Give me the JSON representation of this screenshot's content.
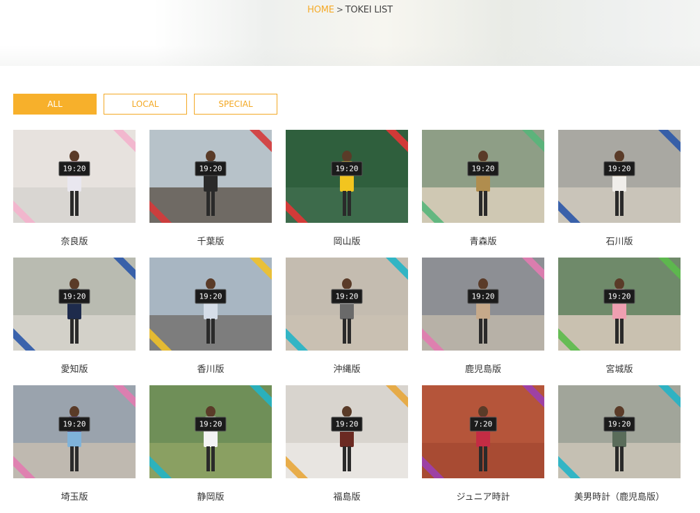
{
  "breadcrumb": {
    "home": "HOME",
    "separator": ">",
    "current": "TOKEI LIST"
  },
  "filters": [
    {
      "label": "ALL",
      "active": true
    },
    {
      "label": "LOCAL",
      "active": false
    },
    {
      "label": "SPECIAL",
      "active": false
    }
  ],
  "accent_color": "#f7b02b",
  "items": [
    {
      "caption": "奈良版",
      "sign": "19:20",
      "bg": "#e7e2de",
      "ground": "#d9d6d2",
      "top": "#f3c7d6",
      "body": "#e9e7ef",
      "ribbon": "#f3b2cc"
    },
    {
      "caption": "千葉版",
      "sign": "19:20",
      "bg": "#b7c2c9",
      "ground": "#6f6a64",
      "top": "#1e1e1e",
      "body": "#2a2a2a",
      "ribbon": "#d53a3a"
    },
    {
      "caption": "岡山版",
      "sign": "19:20",
      "bg": "#2f5f3d",
      "ground": "#3d6b4b",
      "top": "#f3c526",
      "body": "#f2c51f",
      "ribbon": "#e23636"
    },
    {
      "caption": "青森版",
      "sign": "19:20",
      "bg": "#8e9e86",
      "ground": "#cfc8b3",
      "top": "#c9a66a",
      "body": "#b08d4e",
      "ribbon": "#57b57a"
    },
    {
      "caption": "石川版",
      "sign": "19:20",
      "bg": "#a9a8a2",
      "ground": "#c9c4b9",
      "top": "#f0d7b8",
      "body": "#f0eeea",
      "ribbon": "#2a56a8"
    },
    {
      "caption": "愛知版",
      "sign": "19:20",
      "bg": "#b9bbb1",
      "ground": "#d3d1c9",
      "top": "#3c4a63",
      "body": "#1e2b4c",
      "ribbon": "#2a56a8"
    },
    {
      "caption": "香川版",
      "sign": "19:20",
      "bg": "#a8b6c2",
      "ground": "#7d7d7d",
      "top": "#d9dfe7",
      "body": "#d5dde8",
      "ribbon": "#f0c12a"
    },
    {
      "caption": "沖縄版",
      "sign": "19:20",
      "bg": "#c4bcb0",
      "ground": "#c9c0b2",
      "top": "#f2f2f2",
      "body": "#6a6a6a",
      "ribbon": "#22b4c7"
    },
    {
      "caption": "鹿児島版",
      "sign": "19:20",
      "bg": "#8d8f94",
      "ground": "#b7b1a7",
      "top": "#d9c3a7",
      "body": "#c6a98a",
      "ribbon": "#e27bb0"
    },
    {
      "caption": "宮城版",
      "sign": "19:20",
      "bg": "#6f8a6a",
      "ground": "#c9c1b0",
      "top": "#e8a9b4",
      "body": "#ef9fb1",
      "ribbon": "#5bbb4b"
    },
    {
      "caption": "埼玉版",
      "sign": "19:20",
      "bg": "#9aa3ad",
      "ground": "#bfb9b0",
      "top": "#5a3d8a",
      "body": "#7fb2d9",
      "ribbon": "#e27bb0"
    },
    {
      "caption": "静岡版",
      "sign": "19:20",
      "bg": "#6f8f58",
      "ground": "#8aa062",
      "top": "#f4f4f4",
      "body": "#f4f4f4",
      "ribbon": "#22b4c7"
    },
    {
      "caption": "福島版",
      "sign": "19:20",
      "bg": "#d8d4ce",
      "ground": "#e8e5e1",
      "top": "#f4f4f4",
      "body": "#6b2a22",
      "ribbon": "#e8a63a"
    },
    {
      "caption": "ジュニア時計",
      "sign": "7:20",
      "bg": "#b5553a",
      "ground": "#a84b33",
      "top": "#d6314c",
      "body": "#c42c44",
      "ribbon": "#9b3fb0"
    },
    {
      "caption": "美男時計（鹿児島版）",
      "sign": "19:20",
      "bg": "#a1a59a",
      "ground": "#c5c0b3",
      "top": "#2b4a5e",
      "body": "#5a6c5a",
      "ribbon": "#22b4c7"
    }
  ]
}
